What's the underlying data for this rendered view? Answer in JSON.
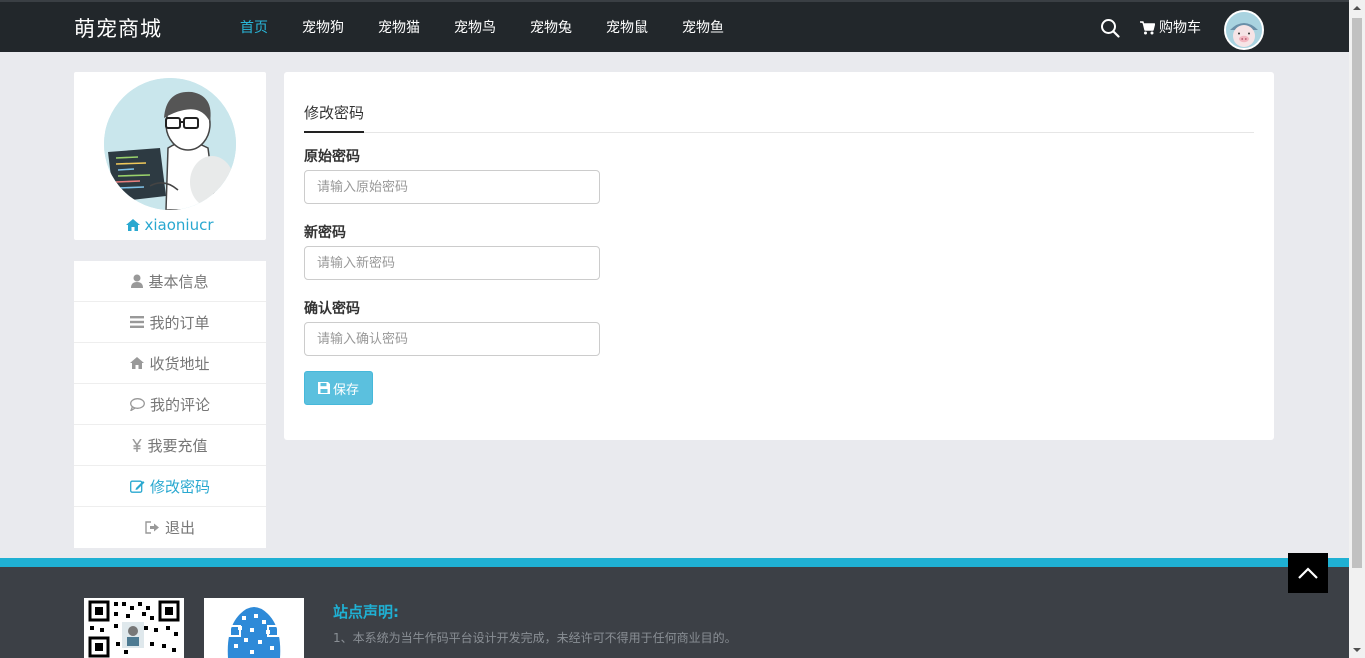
{
  "brand": "萌宠商城",
  "nav": {
    "items": [
      "首页",
      "宠物狗",
      "宠物猫",
      "宠物鸟",
      "宠物兔",
      "宠物鼠",
      "宠物鱼"
    ],
    "active_index": 0,
    "cart_label": "购物车"
  },
  "profile": {
    "username": "xiaoniucr"
  },
  "side_menu": {
    "items": [
      "基本信息",
      "我的订单",
      "收货地址",
      "我的评论",
      "我要充值",
      "修改密码",
      "退出"
    ],
    "icons": [
      "user-icon",
      "list-icon",
      "home-icon",
      "comment-icon",
      "yen-icon",
      "edit-icon",
      "logout-icon"
    ],
    "active_index": 5
  },
  "form": {
    "tab_label": "修改密码",
    "old_password": {
      "label": "原始密码",
      "placeholder": "请输入原始密码",
      "value": ""
    },
    "new_password": {
      "label": "新密码",
      "placeholder": "请输入新密码",
      "value": ""
    },
    "confirm_password": {
      "label": "确认密码",
      "placeholder": "请输入确认密码",
      "value": ""
    },
    "save_label": "保存"
  },
  "footer": {
    "title": "站点声明:",
    "text": "1、本系统为当牛作码平台设计开发完成，未经许可不得用于任何商业目的。"
  },
  "colors": {
    "accent": "#29b6d8",
    "topbar": "#22272b",
    "footer": "#3c4046",
    "save_button": "#5bc0de"
  }
}
